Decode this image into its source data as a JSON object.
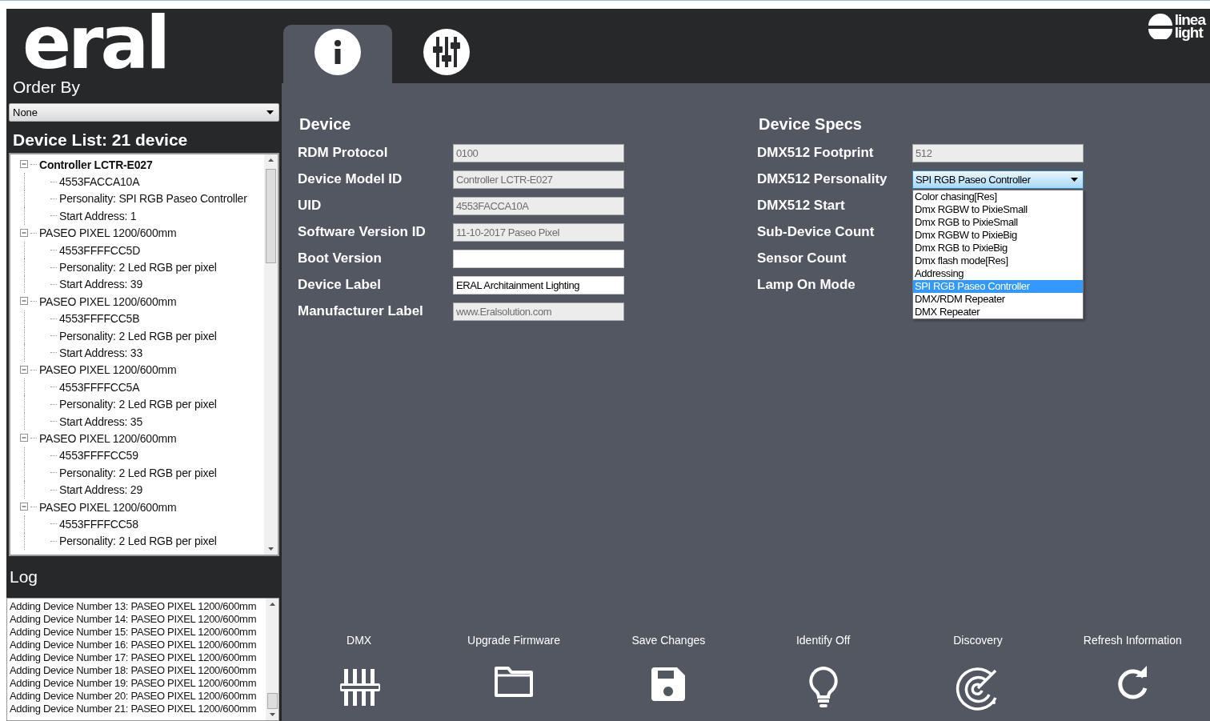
{
  "logo": {
    "text": "eral"
  },
  "brand": {
    "line1": "linea",
    "line2": "light"
  },
  "tabs": [
    {
      "kind": "info",
      "selected": true
    },
    {
      "kind": "mixer",
      "selected": false
    }
  ],
  "sidebar": {
    "order_label": "Order By",
    "order_value": "None",
    "list_title": "Device List: 21 device",
    "tree": [
      {
        "label": "Controller LCTR-E027",
        "bold": true,
        "expanded": true,
        "children": [
          {
            "label": "4553FACCA10A"
          },
          {
            "label": "Personality: SPI RGB Paseo Controller"
          },
          {
            "label": "Start Address: 1"
          }
        ]
      },
      {
        "label": "PASEO PIXEL 1200/600mm",
        "bold": false,
        "expanded": true,
        "children": [
          {
            "label": "4553FFFFCC5D"
          },
          {
            "label": "Personality: 2  Led RGB per pixel"
          },
          {
            "label": "Start Address: 39"
          }
        ]
      },
      {
        "label": "PASEO PIXEL 1200/600mm",
        "bold": false,
        "expanded": true,
        "children": [
          {
            "label": "4553FFFFCC5B"
          },
          {
            "label": "Personality: 2  Led RGB per pixel"
          },
          {
            "label": "Start Address: 33"
          }
        ]
      },
      {
        "label": "PASEO PIXEL 1200/600mm",
        "bold": false,
        "expanded": true,
        "children": [
          {
            "label": "4553FFFFCC5A"
          },
          {
            "label": "Personality: 2  Led RGB per pixel"
          },
          {
            "label": "Start Address: 35"
          }
        ]
      },
      {
        "label": "PASEO PIXEL 1200/600mm",
        "bold": false,
        "expanded": true,
        "children": [
          {
            "label": "4553FFFFCC59"
          },
          {
            "label": "Personality: 2  Led RGB per pixel"
          },
          {
            "label": "Start Address: 29"
          }
        ]
      },
      {
        "label": "PASEO PIXEL 1200/600mm",
        "bold": false,
        "expanded": true,
        "children": [
          {
            "label": "4553FFFFCC58"
          },
          {
            "label": "Personality: 2  Led RGB per pixel"
          }
        ]
      }
    ],
    "log_title": "Log",
    "log": [
      "Adding Device Number 13: PASEO PIXEL 1200/600mm",
      "Adding Device Number 14: PASEO PIXEL 1200/600mm",
      "Adding Device Number 15: PASEO PIXEL 1200/600mm",
      "Adding Device Number 16: PASEO PIXEL 1200/600mm",
      "Adding Device Number 17: PASEO PIXEL 1200/600mm",
      "Adding Device Number 18: PASEO PIXEL 1200/600mm",
      "Adding Device Number 19: PASEO PIXEL 1200/600mm",
      "Adding Device Number 20: PASEO PIXEL 1200/600mm",
      "Adding Device Number 21: PASEO PIXEL 1200/600mm"
    ]
  },
  "device": {
    "title": "Device",
    "fields": [
      {
        "label": "RDM Protocol",
        "kind": "text",
        "disabled": true,
        "value": "0100"
      },
      {
        "label": "Device Model ID",
        "kind": "text",
        "disabled": true,
        "value": "Controller LCTR-E027"
      },
      {
        "label": "UID",
        "kind": "text",
        "disabled": true,
        "value": "4553FACCA10A"
      },
      {
        "label": "Software Version ID",
        "kind": "text",
        "disabled": true,
        "value": "11-10-2017 Paseo Pixel"
      },
      {
        "label": "Boot Version",
        "kind": "text",
        "disabled": false
      },
      {
        "label": "Device Label",
        "kind": "text",
        "disabled": false,
        "value": "ERAL Architainment Lighting"
      },
      {
        "label": "Manufacturer Label",
        "kind": "text",
        "disabled": true,
        "value": "www.Eralsolution.com"
      }
    ]
  },
  "specs": {
    "title": "Device Specs",
    "fields": [
      {
        "label": "DMX512 Footprint",
        "kind": "text",
        "disabled": true,
        "value": "512"
      },
      {
        "label": "DMX512 Personality",
        "kind": "select",
        "disabled": false,
        "value": "SPI RGB Paseo Controller",
        "expanded": true,
        "options": [
          {
            "label": "Color chasing[Res]",
            "selected": false
          },
          {
            "label": "Dmx RGBW to PixieSmall",
            "selected": false
          },
          {
            "label": "Dmx RGB to PixieSmall",
            "selected": false
          },
          {
            "label": "Dmx RGBW to PixieBig",
            "selected": false
          },
          {
            "label": "Dmx RGB to PixieBig",
            "selected": false
          },
          {
            "label": "Dmx flash mode[Res]",
            "selected": false
          },
          {
            "label": "Addressing",
            "selected": false
          },
          {
            "label": "SPI RGB Paseo Controller",
            "selected": true
          },
          {
            "label": "DMX/RDM Repeater",
            "selected": false
          },
          {
            "label": "DMX Repeater",
            "selected": false
          }
        ]
      },
      {
        "label": "DMX512 Start",
        "kind": "none"
      },
      {
        "label": "Sub-Device Count",
        "kind": "none"
      },
      {
        "label": "Sensor Count",
        "kind": "none"
      },
      {
        "label": "Lamp On Mode",
        "kind": "none"
      }
    ]
  },
  "toolbar": [
    {
      "label": "DMX",
      "kind": "mixer"
    },
    {
      "label": "Upgrade Firmware",
      "kind": "folder"
    },
    {
      "label": "Save Changes",
      "kind": "save"
    },
    {
      "label": "Identify Off",
      "kind": "bulb"
    },
    {
      "label": "Discovery",
      "kind": "radar"
    },
    {
      "label": "Refresh Information",
      "kind": "refresh"
    }
  ]
}
